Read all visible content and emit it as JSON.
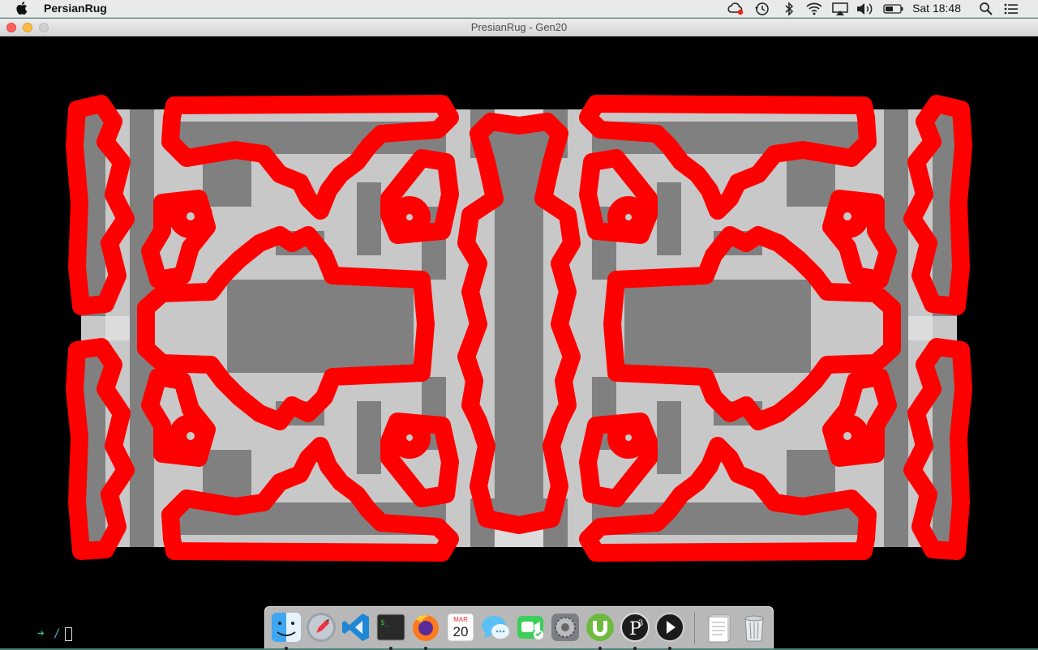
{
  "menubar": {
    "app_name": "PersianRug",
    "clock": "Sat 18:48",
    "tray_icons": [
      "creative-cloud-icon",
      "time-machine-icon",
      "bluetooth-icon",
      "wifi-icon",
      "airplay-icon",
      "volume-icon",
      "battery-icon"
    ],
    "right_icons": [
      "spotlight-icon",
      "notification-center-icon"
    ]
  },
  "window": {
    "title": "PresianRug - Gen20",
    "colors": {
      "background": "#000000",
      "light": "#c8c8c8",
      "dark": "#808080",
      "stroke": "#ff0000"
    }
  },
  "terminal": {
    "prompt_arrow": "➜",
    "path": "/"
  },
  "dock": {
    "calendar_month": "MAR",
    "calendar_day": "20",
    "items": [
      {
        "name": "finder",
        "running": true
      },
      {
        "name": "launchpad",
        "running": false
      },
      {
        "name": "vscode",
        "running": false
      },
      {
        "name": "terminal",
        "running": true
      },
      {
        "name": "firefox",
        "running": true
      },
      {
        "name": "calendar",
        "running": false
      },
      {
        "name": "messages",
        "running": false
      },
      {
        "name": "facetime",
        "running": false
      },
      {
        "name": "system-preferences",
        "running": false
      },
      {
        "name": "utorrent",
        "running": true
      },
      {
        "name": "processing",
        "running": true
      },
      {
        "name": "quicktime",
        "running": true
      },
      {
        "name": "documents",
        "running": false
      },
      {
        "name": "trash",
        "running": false
      }
    ]
  }
}
